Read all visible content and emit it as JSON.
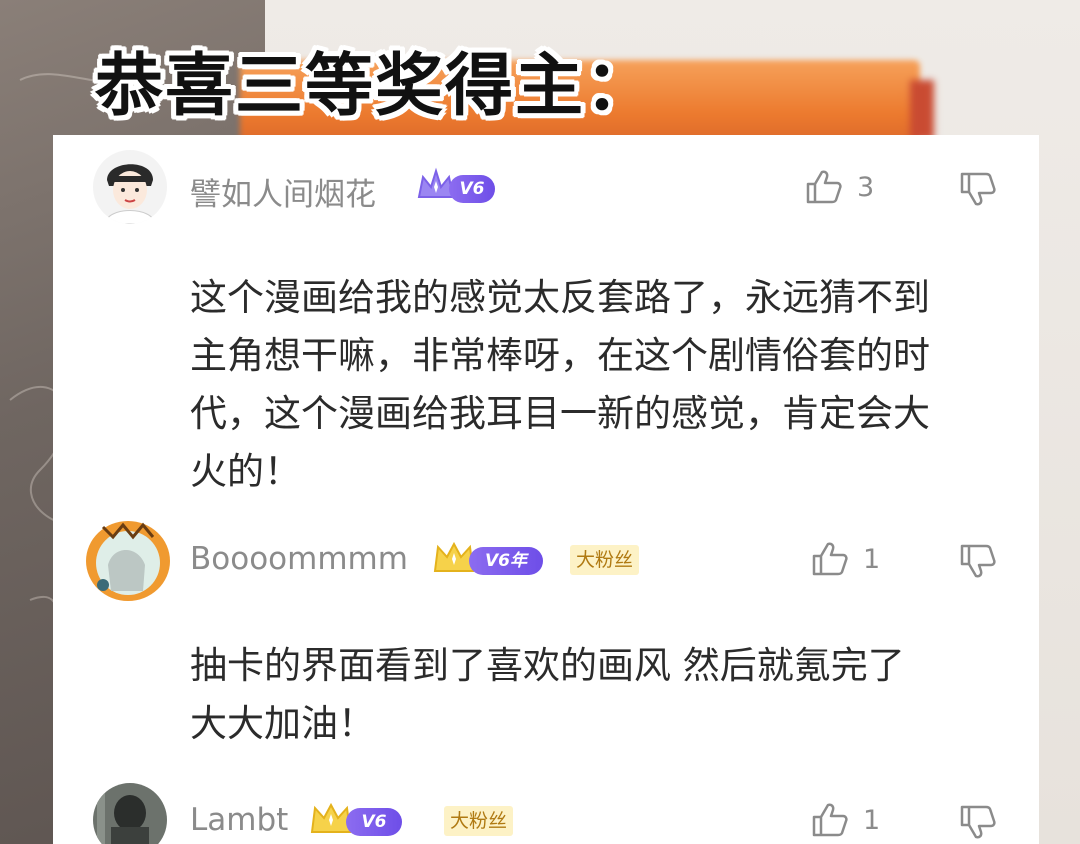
{
  "title": "恭喜三等奖得主：",
  "comments": [
    {
      "username": "譬如人间烟花",
      "level": "V6",
      "likes": "3",
      "lines": [
        "这个漫画给我的感觉太反套路了，永远猜不到",
        "主角想干嘛，非常棒呀，在这个剧情俗套的时",
        "代，这个漫画给我耳目一新的感觉，肯定会大",
        "火的！"
      ]
    },
    {
      "username": "Boooommmm",
      "level": "V6年",
      "fan_badge": "大粉丝",
      "likes": "1",
      "lines": [
        "抽卡的界面看到了喜欢的画风 然后就氪完了",
        "大大加油！"
      ]
    },
    {
      "username": "Lambt",
      "level": "V6",
      "fan_badge": "大粉丝",
      "likes": "1"
    }
  ],
  "icons": {
    "like": "thumbs-up-icon",
    "dislike": "thumbs-down-icon",
    "crown": "crown-icon"
  },
  "colors": {
    "level_badge": "#7a5aec",
    "fan_badge_bg": "#fdf2c6",
    "fan_badge_text": "#b07a12",
    "title_stroke": "#ffffff"
  }
}
